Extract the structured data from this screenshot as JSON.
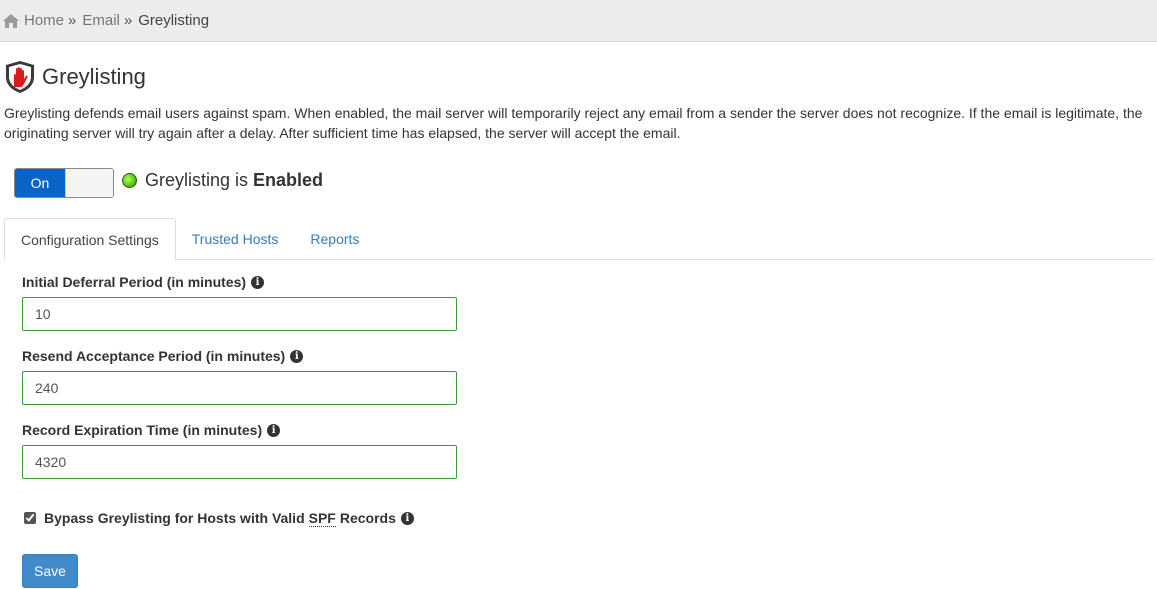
{
  "breadcrumb": {
    "home": "Home",
    "email": "Email",
    "current": "Greylisting",
    "separator": "»"
  },
  "header": {
    "title": "Greylisting"
  },
  "description": "Greylisting defends email users against spam. When enabled, the mail server will temporarily reject any email from a sender the server does not recognize. If the email is legitimate, the originating server will try again after a delay. After sufficient time has elapsed, the server will accept the email.",
  "toggle": {
    "on_label": "On"
  },
  "status": {
    "prefix": "Greylisting is",
    "state": "Enabled"
  },
  "tabs": [
    {
      "label": "Configuration Settings",
      "active": true
    },
    {
      "label": "Trusted Hosts",
      "active": false
    },
    {
      "label": "Reports",
      "active": false
    }
  ],
  "form": {
    "initial_deferral": {
      "label": "Initial Deferral Period (in minutes)",
      "value": "10"
    },
    "resend_acceptance": {
      "label": "Resend Acceptance Period (in minutes)",
      "value": "240"
    },
    "record_expiration": {
      "label": "Record Expiration Time (in minutes)",
      "value": "4320"
    },
    "bypass": {
      "label_before": "Bypass Greylisting for Hosts with Valid",
      "abbr": "SPF",
      "label_after": "Records",
      "checked": true
    },
    "save_label": "Save"
  },
  "colors": {
    "toggle_on": "#0a64c8",
    "status_dot": "#5ccb18",
    "link": "#3a7bbd",
    "input_border": "#3c9a3c",
    "save_button": "#428bca"
  }
}
